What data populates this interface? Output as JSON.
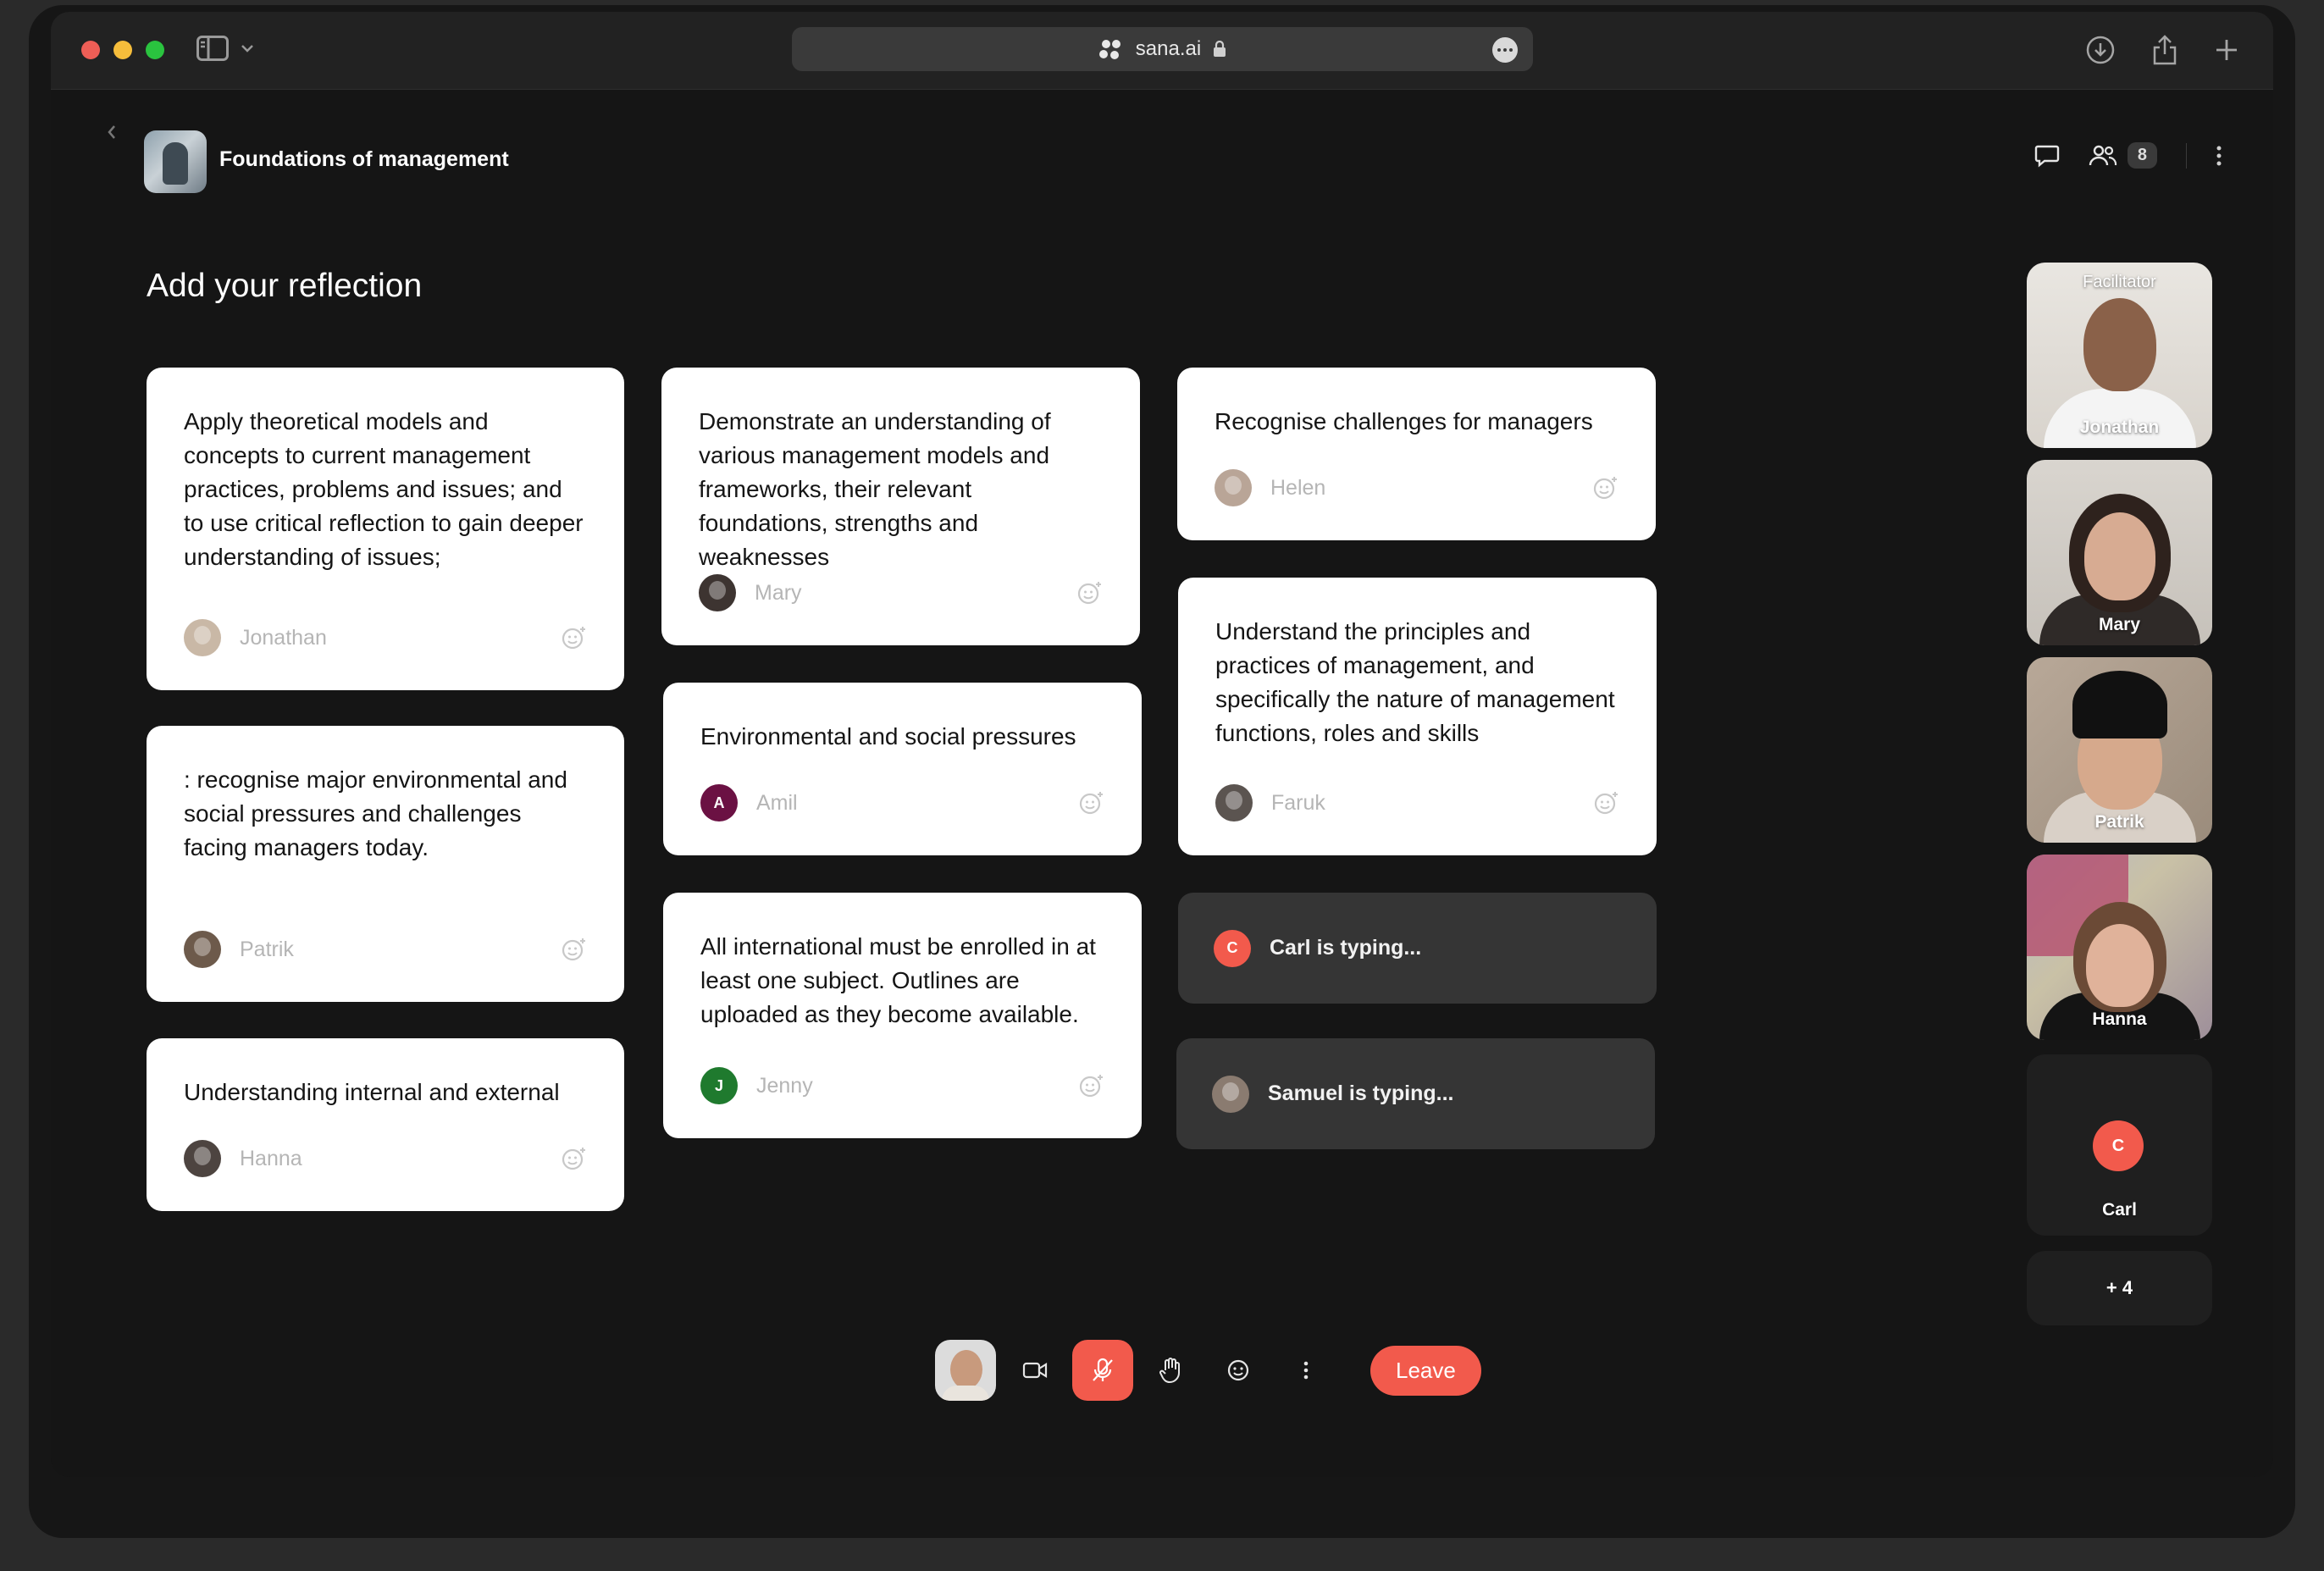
{
  "browser": {
    "url": "sana.ai"
  },
  "header": {
    "course_title": "Foundations of management",
    "participant_count": "8"
  },
  "page_title": "Add your reflection",
  "cards": [
    {
      "text": "Apply theoretical models and concepts to current management practices, problems and issues; and to use critical reflection to gain deeper understanding of issues;",
      "author": "Jonathan"
    },
    {
      "text": ": recognise major environmental and social pressures and challenges facing managers today.",
      "author": "Patrik"
    },
    {
      "text": "Understanding internal and external",
      "author": "Hanna"
    },
    {
      "text": "Demonstrate an understanding of various management models and frameworks, their relevant foundations, strengths and weaknesses",
      "author": "Mary"
    },
    {
      "text": "Environmental and social pressures",
      "author": "Amil",
      "initial": "A"
    },
    {
      "text": "All international must be enrolled in at least one subject. Outlines are uploaded as they become available.",
      "author": "Jenny",
      "initial": "J"
    },
    {
      "text": "Recognise challenges for managers",
      "author": "Helen"
    },
    {
      "text": "Understand the principles and practices of management, and specifically the nature of management functions, roles and skills",
      "author": "Faruk"
    }
  ],
  "typing": [
    {
      "label": "Carl is typing...",
      "initial": "C"
    },
    {
      "label": "Samuel is typing..."
    }
  ],
  "participants": [
    {
      "name": "Jonathan",
      "role": "Facilitator"
    },
    {
      "name": "Mary"
    },
    {
      "name": "Patrik"
    },
    {
      "name": "Hanna"
    },
    {
      "name": "Carl",
      "initial": "C"
    }
  ],
  "more_participants": "+ 4",
  "controls": {
    "leave_label": "Leave"
  },
  "colors": {
    "accent": "#f25a4c",
    "card": "#ffffff",
    "background": "#151515",
    "amil": "#6b1143",
    "jenny": "#1f7a2e"
  }
}
